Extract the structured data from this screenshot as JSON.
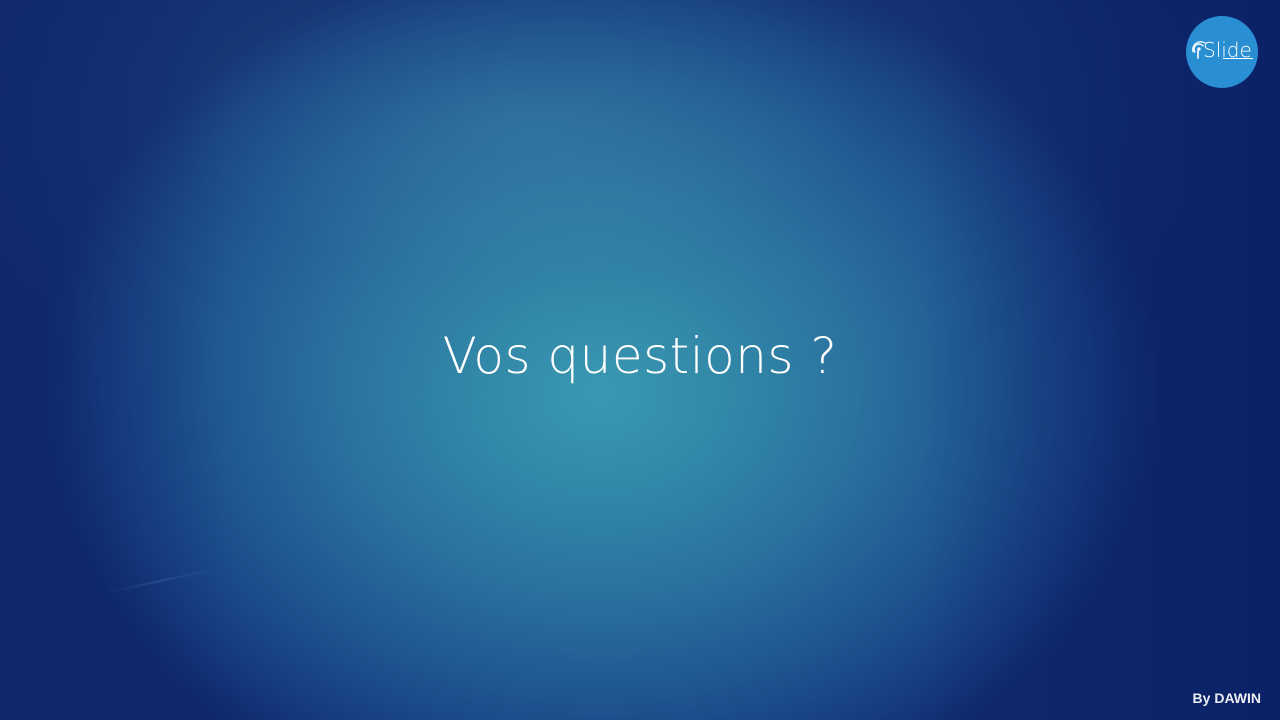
{
  "slide": {
    "title": "Vos questions ?",
    "footer": "By DAWIN"
  },
  "logo": {
    "text": "Slide",
    "background_color": "#2a8fd2"
  },
  "colors": {
    "background_center": "#3a9ab3",
    "background_edge": "#10296e",
    "text": "#ffffff"
  }
}
